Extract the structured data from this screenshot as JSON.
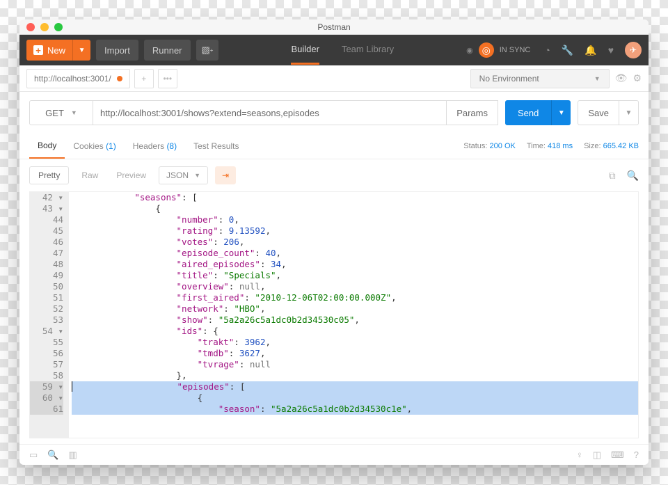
{
  "app_title": "Postman",
  "toolbar": {
    "new": "New",
    "import": "Import",
    "runner": "Runner",
    "builder": "Builder",
    "team_library": "Team Library",
    "sync": "IN SYNC"
  },
  "request_tab": {
    "label": "http://localhost:3001/"
  },
  "environment": {
    "selected": "No Environment"
  },
  "request": {
    "method": "GET",
    "url": "http://localhost:3001/shows?extend=seasons,episodes",
    "params": "Params",
    "send": "Send",
    "save": "Save"
  },
  "response_tabs": {
    "body": "Body",
    "cookies": "Cookies",
    "cookies_count": "(1)",
    "headers": "Headers",
    "headers_count": "(8)",
    "test_results": "Test Results"
  },
  "status": {
    "status_label": "Status:",
    "status_value": "200 OK",
    "time_label": "Time:",
    "time_value": "418 ms",
    "size_label": "Size:",
    "size_value": "665.42 KB"
  },
  "viewbar": {
    "pretty": "Pretty",
    "raw": "Raw",
    "preview": "Preview",
    "format": "JSON"
  },
  "code": {
    "lines": [
      {
        "n": "42 ▾",
        "i": 3,
        "t": [
          [
            "k",
            "\"seasons\""
          ],
          [
            "pu",
            ": ["
          ]
        ]
      },
      {
        "n": "43 ▾",
        "i": 4,
        "t": [
          [
            "pu",
            "{"
          ]
        ]
      },
      {
        "n": "44",
        "i": 5,
        "t": [
          [
            "k",
            "\"number\""
          ],
          [
            "pu",
            ": "
          ],
          [
            "n",
            "0"
          ],
          [
            "pu",
            ","
          ]
        ]
      },
      {
        "n": "45",
        "i": 5,
        "t": [
          [
            "k",
            "\"rating\""
          ],
          [
            "pu",
            ": "
          ],
          [
            "n",
            "9.13592"
          ],
          [
            "pu",
            ","
          ]
        ]
      },
      {
        "n": "46",
        "i": 5,
        "t": [
          [
            "k",
            "\"votes\""
          ],
          [
            "pu",
            ": "
          ],
          [
            "n",
            "206"
          ],
          [
            "pu",
            ","
          ]
        ]
      },
      {
        "n": "47",
        "i": 5,
        "t": [
          [
            "k",
            "\"episode_count\""
          ],
          [
            "pu",
            ": "
          ],
          [
            "n",
            "40"
          ],
          [
            "pu",
            ","
          ]
        ]
      },
      {
        "n": "48",
        "i": 5,
        "t": [
          [
            "k",
            "\"aired_episodes\""
          ],
          [
            "pu",
            ": "
          ],
          [
            "n",
            "34"
          ],
          [
            "pu",
            ","
          ]
        ]
      },
      {
        "n": "49",
        "i": 5,
        "t": [
          [
            "k",
            "\"title\""
          ],
          [
            "pu",
            ": "
          ],
          [
            "s",
            "\"Specials\""
          ],
          [
            "pu",
            ","
          ]
        ]
      },
      {
        "n": "50",
        "i": 5,
        "t": [
          [
            "k",
            "\"overview\""
          ],
          [
            "pu",
            ": "
          ],
          [
            "nu",
            "null"
          ],
          [
            "pu",
            ","
          ]
        ]
      },
      {
        "n": "51",
        "i": 5,
        "t": [
          [
            "k",
            "\"first_aired\""
          ],
          [
            "pu",
            ": "
          ],
          [
            "s",
            "\"2010-12-06T02:00:00.000Z\""
          ],
          [
            "pu",
            ","
          ]
        ]
      },
      {
        "n": "52",
        "i": 5,
        "t": [
          [
            "k",
            "\"network\""
          ],
          [
            "pu",
            ": "
          ],
          [
            "s",
            "\"HBO\""
          ],
          [
            "pu",
            ","
          ]
        ]
      },
      {
        "n": "53",
        "i": 5,
        "t": [
          [
            "k",
            "\"show\""
          ],
          [
            "pu",
            ": "
          ],
          [
            "s",
            "\"5a2a26c5a1dc0b2d34530c05\""
          ],
          [
            "pu",
            ","
          ]
        ]
      },
      {
        "n": "54 ▾",
        "i": 5,
        "t": [
          [
            "k",
            "\"ids\""
          ],
          [
            "pu",
            ": {"
          ]
        ]
      },
      {
        "n": "55",
        "i": 6,
        "t": [
          [
            "k",
            "\"trakt\""
          ],
          [
            "pu",
            ": "
          ],
          [
            "n",
            "3962"
          ],
          [
            "pu",
            ","
          ]
        ]
      },
      {
        "n": "56",
        "i": 6,
        "t": [
          [
            "k",
            "\"tmdb\""
          ],
          [
            "pu",
            ": "
          ],
          [
            "n",
            "3627"
          ],
          [
            "pu",
            ","
          ]
        ]
      },
      {
        "n": "57",
        "i": 6,
        "t": [
          [
            "k",
            "\"tvrage\""
          ],
          [
            "pu",
            ": "
          ],
          [
            "nu",
            "null"
          ]
        ]
      },
      {
        "n": "58",
        "i": 5,
        "t": [
          [
            "pu",
            "},"
          ]
        ]
      },
      {
        "n": "59 ▾",
        "i": 5,
        "t": [
          [
            "k",
            "\"episodes\""
          ],
          [
            "pu",
            ": ["
          ]
        ],
        "hl": true,
        "cursor": true
      },
      {
        "n": "60 ▾",
        "i": 6,
        "t": [
          [
            "pu",
            "{"
          ]
        ],
        "hl": true
      },
      {
        "n": "61",
        "i": 7,
        "t": [
          [
            "k",
            "\"season\""
          ],
          [
            "pu",
            ": "
          ],
          [
            "s",
            "\"5a2a26c5a1dc0b2d34530c1e\""
          ],
          [
            "pu",
            ","
          ]
        ],
        "hl": true
      }
    ]
  }
}
